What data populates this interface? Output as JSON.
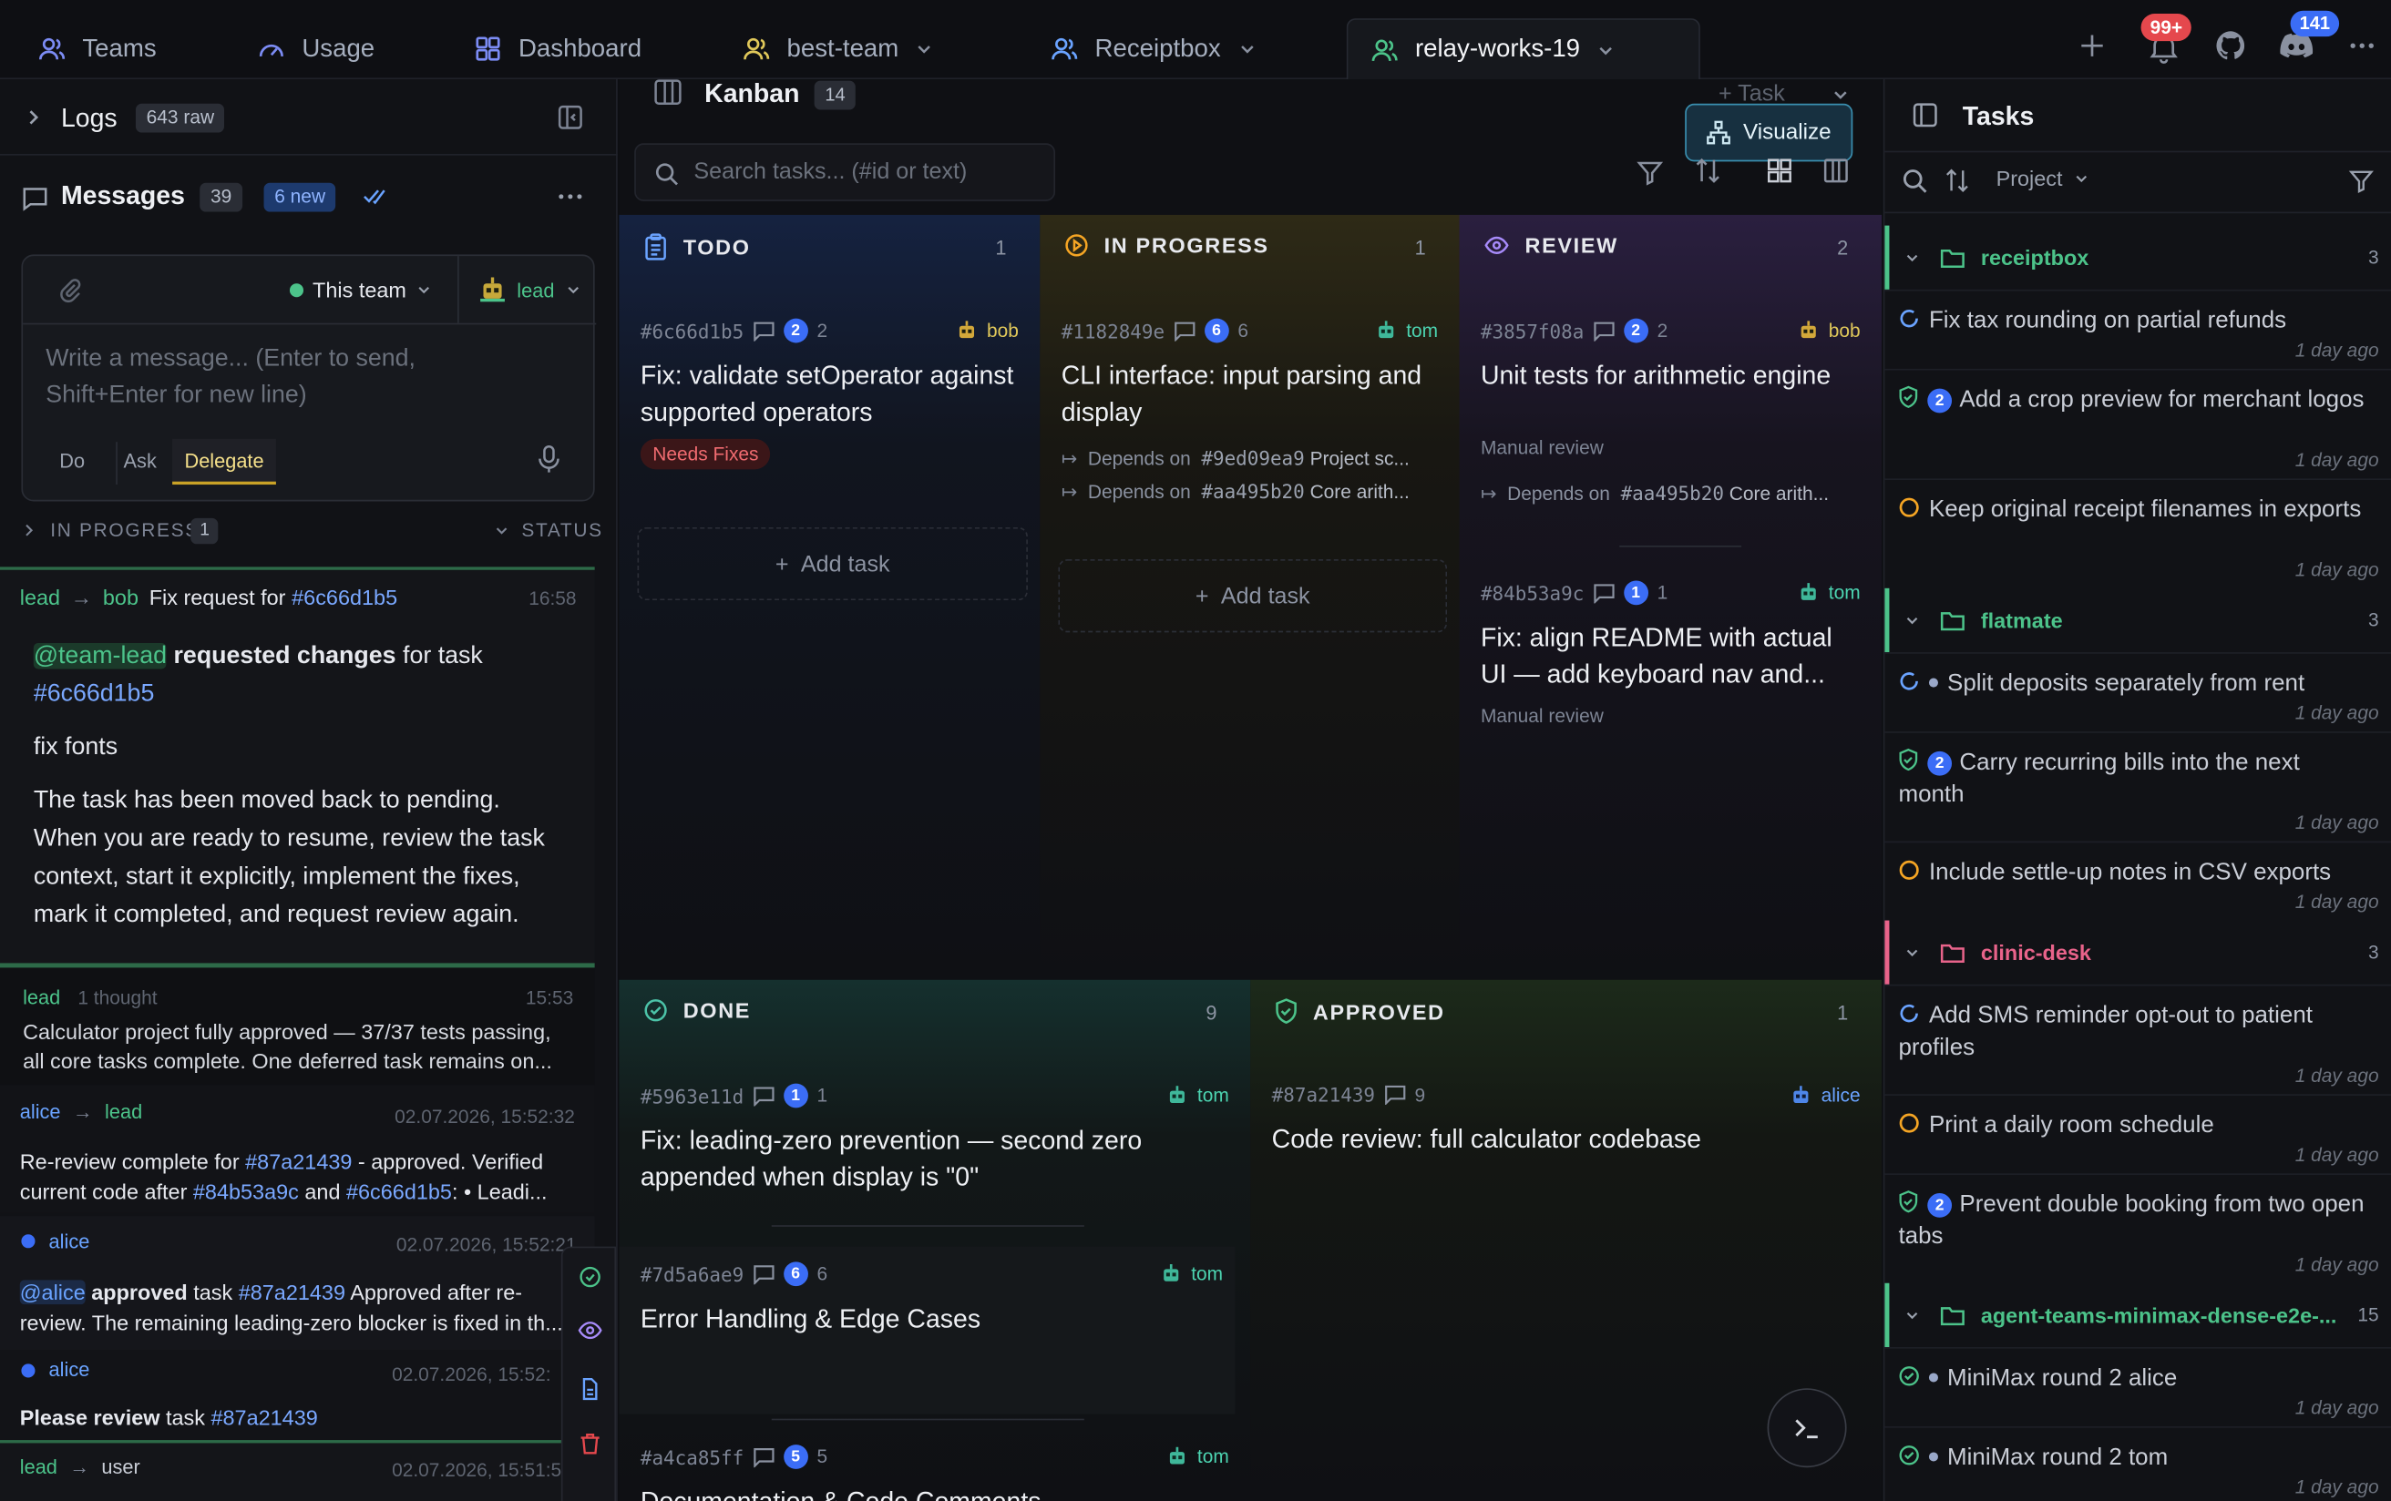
{
  "topbar": {
    "tabs": [
      {
        "label": "Teams",
        "icon": "users-icon"
      },
      {
        "label": "Usage",
        "icon": "gauge-icon"
      },
      {
        "label": "Dashboard",
        "icon": "grid-icon"
      },
      {
        "label": "best-team",
        "icon": "users-icon"
      },
      {
        "label": "Receiptbox",
        "icon": "users-icon"
      },
      {
        "label": "relay-works-19",
        "icon": "users-icon"
      }
    ],
    "notifications_badge": "99+",
    "discord_badge": "141"
  },
  "logs": {
    "label": "Logs",
    "count": "643 raw"
  },
  "messages": {
    "label": "Messages",
    "count": "39",
    "new_badge": "6 new",
    "scope": "This team",
    "recipient": "lead",
    "placeholder": "Write a message... (Enter to send, Shift+Enter for new line)",
    "modes": [
      "Do",
      "Ask",
      "Delegate"
    ],
    "active_mode": "Delegate",
    "status_row": {
      "label": "IN PROGRESS",
      "count": "1",
      "status": "STATUS"
    }
  },
  "feed": [
    {
      "from": "lead",
      "to": "bob",
      "subject": "Fix request for",
      "hash": "#6c66d1b5",
      "time": "16:58",
      "mention": "@team-lead",
      "strong": "requested changes",
      "mid": "for task",
      "task": "#6c66d1b5",
      "p1": "fix fonts",
      "p2": "The task has been moved back to pending. When you are ready to resume, review the task context, start it explicitly, implement the fixes, mark it completed, and request review again."
    },
    {
      "from": "lead",
      "meta": "1 thought",
      "time": "15:53",
      "text": "Calculator project fully approved — 37/37 tests passing, all core tasks complete. One deferred task remains on..."
    },
    {
      "from": "alice",
      "to": "lead",
      "time": "02.07.2026, 15:52:32",
      "t1": "Re-review complete for",
      "h1": "#87a21439",
      "t2": "- approved. Verified current code after",
      "h2": "#84b53a9c",
      "t3": "and",
      "h3": "#6c66d1b5",
      "t4": ": • Leadi..."
    },
    {
      "from": "alice",
      "time": "02.07.2026, 15:52:21",
      "mention": "@alice",
      "strong": "approved",
      "t1": "task",
      "h1": "#87a21439",
      "t2": "Approved after re-review. The remaining leading-zero blocker is fixed in th..."
    },
    {
      "from": "alice",
      "time": "02.07.2026, 15:52:",
      "strong": "Please review",
      "t1": "task",
      "h1": "#87a21439"
    },
    {
      "from": "lead",
      "to": "user",
      "time": "02.07.2026, 15:51:5"
    }
  ],
  "kanban": {
    "title": "Kanban",
    "count": "14",
    "add_task": "+ Task",
    "visualize": "Visualize",
    "search_placeholder": "Search tasks... (#id or text)",
    "add_card_label": "Add task",
    "columns": {
      "todo": {
        "name": "TODO",
        "count": "1",
        "cards": [
          {
            "id": "#6c66d1b5",
            "comments": "2",
            "n": "2",
            "assignee": "bob",
            "title": "Fix: validate setOperator against supported operators",
            "tag": "Needs Fixes"
          }
        ]
      },
      "inprogress": {
        "name": "IN PROGRESS",
        "count": "1",
        "cards": [
          {
            "id": "#1182849e",
            "comments": "6",
            "n": "6",
            "assignee": "tom",
            "title": "CLI interface: input parsing and display",
            "deps": [
              {
                "label": "Depends on",
                "hash": "#9ed09ea9",
                "text": "Project sc..."
              },
              {
                "label": "Depends on",
                "hash": "#aa495b20",
                "text": "Core arith..."
              }
            ]
          }
        ]
      },
      "review": {
        "name": "REVIEW",
        "count": "2",
        "cards": [
          {
            "id": "#3857f08a",
            "comments": "2",
            "n": "2",
            "assignee": "bob",
            "title": "Unit tests for arithmetic engine",
            "note": "Manual review",
            "dep": {
              "label": "Depends on",
              "hash": "#aa495b20",
              "text": "Core arith..."
            }
          },
          {
            "id": "#84b53a9c",
            "comments": "1",
            "n": "1",
            "assignee": "tom",
            "title": "Fix: align README with actual UI — add keyboard nav and...",
            "note": "Manual review"
          }
        ]
      },
      "done": {
        "name": "DONE",
        "count": "9",
        "cards": [
          {
            "id": "#5963e11d",
            "comments": "1",
            "n": "1",
            "assignee": "tom",
            "title": "Fix: leading-zero prevention — second zero appended when display is \"0\""
          },
          {
            "id": "#7d5a6ae9",
            "comments": "6",
            "n": "6",
            "assignee": "tom",
            "title": "Error Handling & Edge Cases"
          },
          {
            "id": "#a4ca85ff",
            "comments": "5",
            "n": "5",
            "assignee": "tom",
            "title": "Documentation & Code Comments"
          }
        ]
      },
      "approved": {
        "name": "APPROVED",
        "count": "1",
        "cards": [
          {
            "id": "#87a21439",
            "n": "9",
            "assignee": "alice",
            "title": "Code review: full calculator codebase"
          }
        ]
      }
    }
  },
  "tasks_panel": {
    "title": "Tasks",
    "filter": "Project",
    "groups": [
      {
        "name": "receiptbox",
        "count": "3",
        "color": "#4cc38a",
        "tasks": [
          {
            "title": "Fix tax rounding on partial refunds",
            "ago": "1 day ago",
            "status": "in-progress"
          },
          {
            "title": "Add a crop preview for merchant logos",
            "ago": "1 day ago",
            "status": "review",
            "badge": "2"
          },
          {
            "title": "Keep original receipt filenames in exports",
            "ago": "1 day ago",
            "status": "todo"
          }
        ]
      },
      {
        "name": "flatmate",
        "count": "3",
        "color": "#4cc38a",
        "tasks": [
          {
            "title": "Split deposits separately from rent",
            "ago": "1 day ago",
            "status": "in-progress",
            "dot": "true"
          },
          {
            "title": "Carry recurring bills into the next month",
            "ago": "1 day ago",
            "status": "review",
            "badge": "2"
          },
          {
            "title": "Include settle-up notes in CSV exports",
            "ago": "1 day ago",
            "status": "todo"
          }
        ]
      },
      {
        "name": "clinic-desk",
        "count": "3",
        "color": "#e8638a",
        "tasks": [
          {
            "title": "Add SMS reminder opt-out to patient profiles",
            "ago": "1 day ago",
            "status": "in-progress"
          },
          {
            "title": "Print a daily room schedule",
            "ago": "1 day ago",
            "status": "todo"
          },
          {
            "title": "Prevent double booking from two open tabs",
            "ago": "1 day ago",
            "status": "review",
            "badge": "2"
          }
        ]
      },
      {
        "name": "agent-teams-minimax-dense-e2e-...",
        "count": "15",
        "color": "#4cc38a",
        "tasks": [
          {
            "title": "MiniMax round 2 alice",
            "ago": "1 day ago",
            "status": "done",
            "dot": "true"
          },
          {
            "title": "MiniMax round 2 tom",
            "ago": "1 day ago",
            "status": "done",
            "dot": "true"
          }
        ]
      }
    ]
  },
  "colors": {
    "accent_green": "#4cc38a",
    "accent_blue": "#3b6df6",
    "needs_fixes": "#e5484d",
    "in_progress": "#f5a524",
    "review": "#a78bfa"
  }
}
